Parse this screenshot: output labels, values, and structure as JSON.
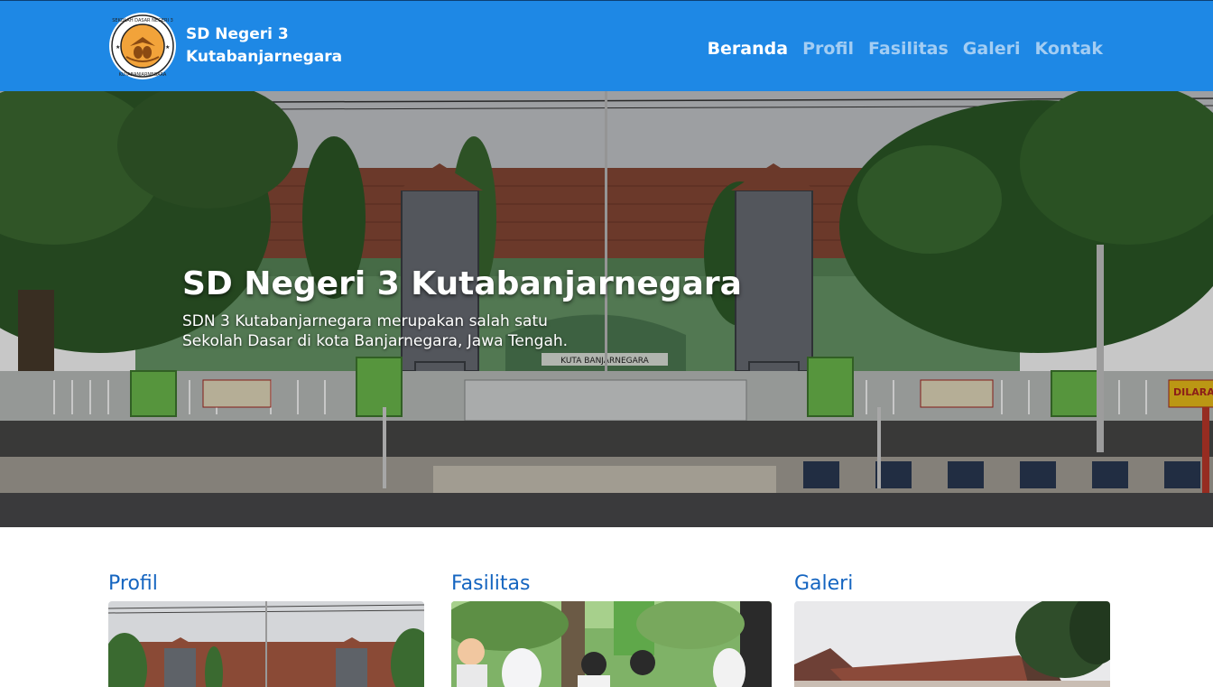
{
  "brand": {
    "line1": "SD Negeri 3",
    "line2": "Kutabanjarnegara",
    "logo_text": "SEKOLAH DASAR NEGERI 3 KUTABANJARNEGARA"
  },
  "nav": [
    {
      "label": "Beranda",
      "active": true
    },
    {
      "label": "Profil",
      "active": false
    },
    {
      "label": "Fasilitas",
      "active": false
    },
    {
      "label": "Galeri",
      "active": false
    },
    {
      "label": "Kontak",
      "active": false
    }
  ],
  "hero": {
    "title": "SD Negeri 3 Kutabanjarnegara",
    "description": "SDN 3 Kutabanjarnegara merupakan salah satu Sekolah Dasar di kota Banjarnegara, Jawa Tengah.",
    "gate_sign": "KUTA BANJARNEGARA",
    "banner_right": "DILARANG"
  },
  "cards": [
    {
      "title": "Profil"
    },
    {
      "title": "Fasilitas"
    },
    {
      "title": "Galeri"
    }
  ],
  "colors": {
    "nav_bg": "#1e88e5",
    "nav_active": "#ffffff",
    "nav_inactive": "#a3cdf3",
    "heading": "#1565c0"
  }
}
